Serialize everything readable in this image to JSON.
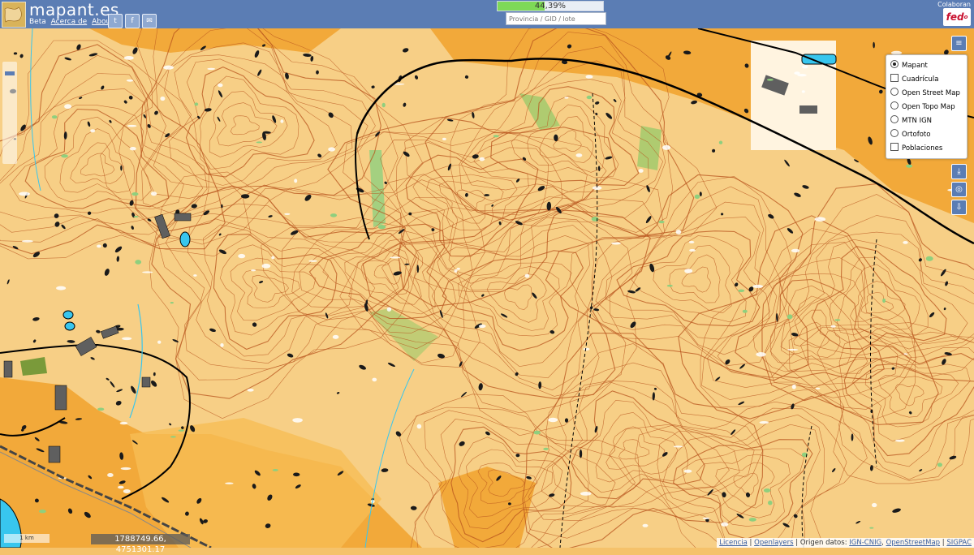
{
  "header": {
    "title": "mapant.es",
    "beta": "Beta",
    "link_acerca": "Acerca de",
    "link_about": "About",
    "social": [
      {
        "icon": "twitter-icon",
        "glyph": "t"
      },
      {
        "icon": "facebook-icon",
        "glyph": "f"
      },
      {
        "icon": "email-icon",
        "glyph": "✉"
      }
    ],
    "progress_text": "44,39%",
    "progress_value": 0.4439,
    "search_placeholder": "Provincia / GID / lote",
    "collab_label": "Colaboran",
    "sponsor_logo_text": "fed"
  },
  "controls": {
    "layers_icon": "layers-icon",
    "download_icon": "download-icon",
    "locate_icon": "target-icon",
    "export_icon": "export-icon"
  },
  "layers": {
    "options": [
      {
        "type": "radio",
        "label": "Mapant",
        "checked": true
      },
      {
        "type": "checkbox",
        "label": "Cuadrícula",
        "checked": false
      },
      {
        "type": "radio",
        "label": "Open Street Map",
        "checked": false
      },
      {
        "type": "radio",
        "label": "Open Topo Map",
        "checked": false
      },
      {
        "type": "radio",
        "label": "MTN IGN",
        "checked": false
      },
      {
        "type": "radio",
        "label": "Ortofoto",
        "checked": false
      },
      {
        "type": "checkbox",
        "label": "Poblaciones",
        "checked": false
      }
    ]
  },
  "map": {
    "coordinates": "1788749.66, 4751301.17",
    "scale_label": "1 km",
    "colors": {
      "open": "#f2a93a",
      "rough": "#fbdc9a",
      "contour": "#b8541d",
      "green": "#8fcf7e",
      "rock": "#1a1a1a",
      "building": "#5f5f5f",
      "water": "#38c6ee"
    }
  },
  "attribution": {
    "licencia": "Licencia",
    "sep1": " | ",
    "openlayers": "Openlayers",
    "origen": " | Origen datos: ",
    "ign": "IGN-CNIG",
    "comma": ", ",
    "osm": "OpenStreetMap",
    "sep2": " | ",
    "sigpac": "SIGPAC"
  }
}
